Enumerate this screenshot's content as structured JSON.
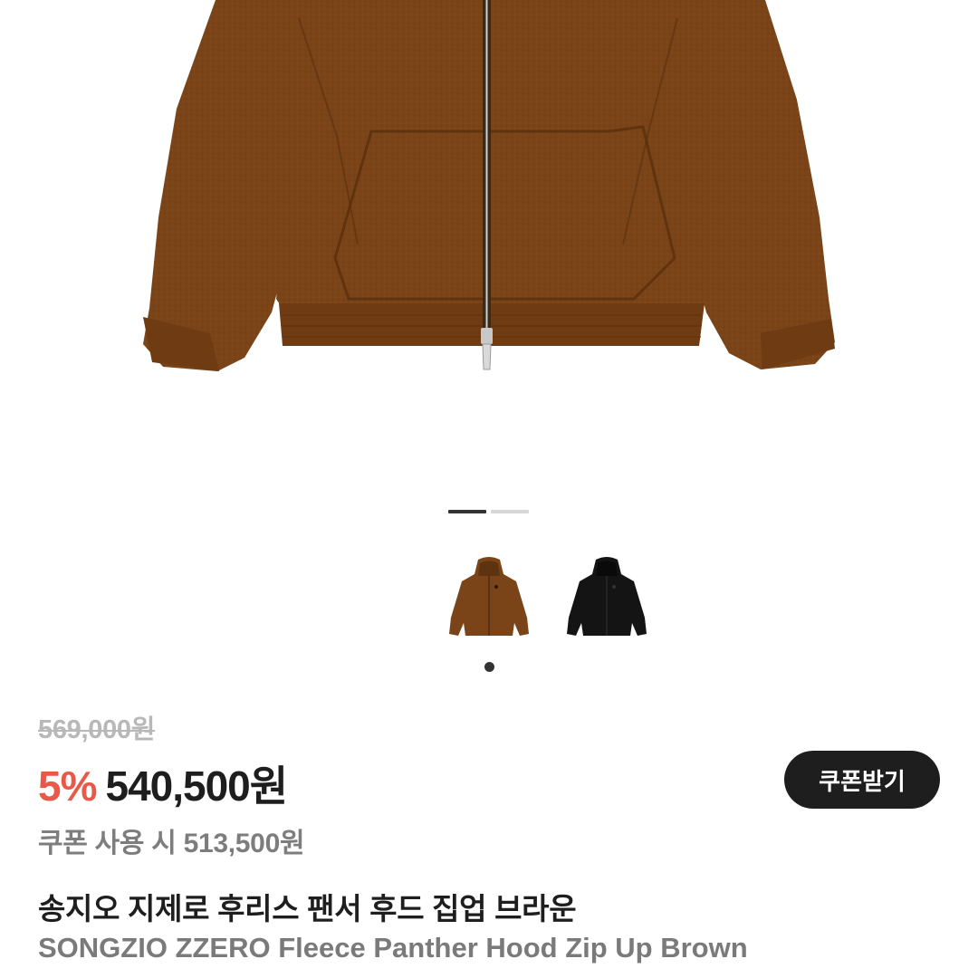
{
  "product": {
    "image_alt": "SONGZIO ZZERO Fleece Panther Hood Zip Up Brown",
    "name_ko": "송지오 지제로 후리스 팬서 후드 집업 브라운",
    "name_en": "SONGZIO ZZERO Fleece Panther Hood Zip Up Brown",
    "colors": {
      "brown": "#7a4418",
      "black": "#141414"
    }
  },
  "carousel": {
    "total": 2,
    "active_index": 0
  },
  "variants": [
    {
      "name": "brown",
      "thumb_icon": "brown-hoodie-thumbnail",
      "selected": true
    },
    {
      "name": "black",
      "thumb_icon": "black-hoodie-thumbnail",
      "selected": false
    }
  ],
  "pricing": {
    "original_price": "569,000원",
    "discount_rate": "5%",
    "sale_price": "540,500원",
    "coupon_button_label": "쿠폰받기",
    "coupon_price_note": "쿠폰 사용 시 513,500원",
    "accent_color": "#e8594a"
  }
}
